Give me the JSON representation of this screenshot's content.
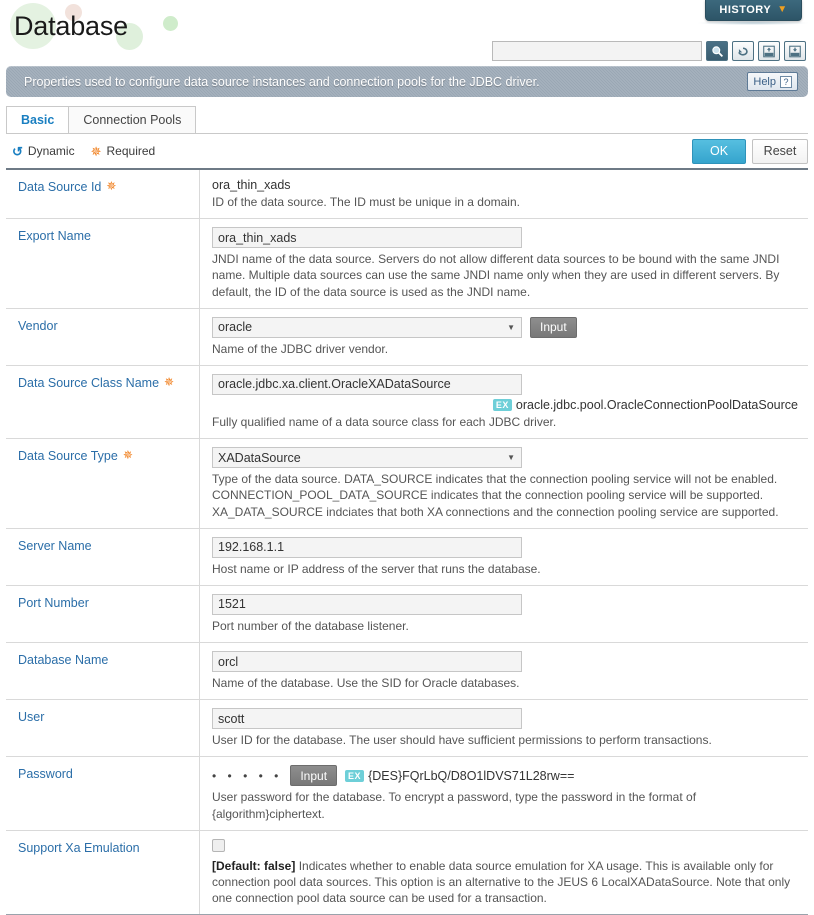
{
  "header": {
    "title": "Database",
    "history_label": "HISTORY",
    "history_caret": "chevron-down-icon",
    "search_value": "",
    "search_placeholder": "",
    "toolbar_icons": [
      "search-icon",
      "reload-icon",
      "xml-import-icon",
      "xml-export-icon"
    ]
  },
  "description": {
    "text": "Properties used to configure data source instances and connection pools for the JDBC driver.",
    "help_label": "Help"
  },
  "tabs": [
    {
      "label": "Basic",
      "active": true
    },
    {
      "label": "Connection Pools",
      "active": false
    }
  ],
  "legend": {
    "dynamic_label": "Dynamic",
    "required_label": "Required",
    "dynamic_icon": "dynamic-refresh-icon",
    "required_icon": "required-asterisk-icon"
  },
  "actions": {
    "ok_label": "OK",
    "reset_label": "Reset"
  },
  "rows": [
    {
      "label": "Data Source Id",
      "required": true,
      "control": "text-static",
      "value": "ora_thin_xads",
      "hint": "ID of the data source. The ID must be unique in a domain."
    },
    {
      "label": "Export Name",
      "required": false,
      "control": "input",
      "value": "ora_thin_xads",
      "hint": "JNDI name of the data source. Servers do not allow different data sources to be bound with the same JNDI name. Multiple data sources can use the same JNDI name only when they are used in different servers. By default, the ID of the data source is used as the JNDI name."
    },
    {
      "label": "Vendor",
      "required": false,
      "control": "select-with-button",
      "value": "oracle",
      "button_label": "Input",
      "hint": "Name of the JDBC driver vendor."
    },
    {
      "label": "Data Source Class Name",
      "required": true,
      "control": "input-with-ex",
      "value": "oracle.jdbc.xa.client.OracleXADataSource",
      "ex_badge": "EX",
      "ex_value": "oracle.jdbc.pool.OracleConnectionPoolDataSource",
      "hint": "Fully qualified name of a data source class for each JDBC driver."
    },
    {
      "label": "Data Source Type",
      "required": true,
      "control": "select",
      "value": "XADataSource",
      "hint": "Type of the data source. DATA_SOURCE indicates that the connection pooling service will not be enabled. CONNECTION_POOL_DATA_SOURCE indicates that the connection pooling service will be supported. XA_DATA_SOURCE indciates that both XA connections and the connection pooling service are supported."
    },
    {
      "label": "Server Name",
      "required": false,
      "control": "input",
      "value": "192.168.1.1",
      "hint": "Host name or IP address of the server that runs the database."
    },
    {
      "label": "Port Number",
      "required": false,
      "control": "input",
      "value": "1521",
      "hint": "Port number of the database listener."
    },
    {
      "label": "Database Name",
      "required": false,
      "control": "input",
      "value": "orcl",
      "hint": "Name of the database. Use the SID for Oracle databases."
    },
    {
      "label": "User",
      "required": false,
      "control": "input",
      "value": "scott",
      "hint": "User ID for the database. The user should have sufficient permissions to perform transactions."
    },
    {
      "label": "Password",
      "required": false,
      "control": "password",
      "value": "• • • • •",
      "button_label": "Input",
      "ex_badge": "EX",
      "ex_value": "{DES}FQrLbQ/D8O1lDVS71L28rw==",
      "hint": "User password for the database. To encrypt a password, type the password in the format of {algorithm}ciphertext."
    },
    {
      "label": "Support Xa Emulation",
      "required": false,
      "control": "checkbox",
      "checked": false,
      "default_prefix": "[Default: false]",
      "hint": "Indicates whether to enable data source emulation for XA usage. This is available only for connection pool data sources. This option is an alternative to the JEUS 6 LocalXADataSource. Note that only one connection pool data source can be used for a transaction."
    }
  ],
  "colors": {
    "label_blue": "#2b6ea8",
    "accent_blue": "#1a7fc1",
    "required_orange": "#f07c18",
    "ok_blue": "#35a4cd",
    "ex_teal": "#6ecfd8",
    "descbar_gray": "#9aa7b4",
    "history_teal": "#2d5567"
  }
}
